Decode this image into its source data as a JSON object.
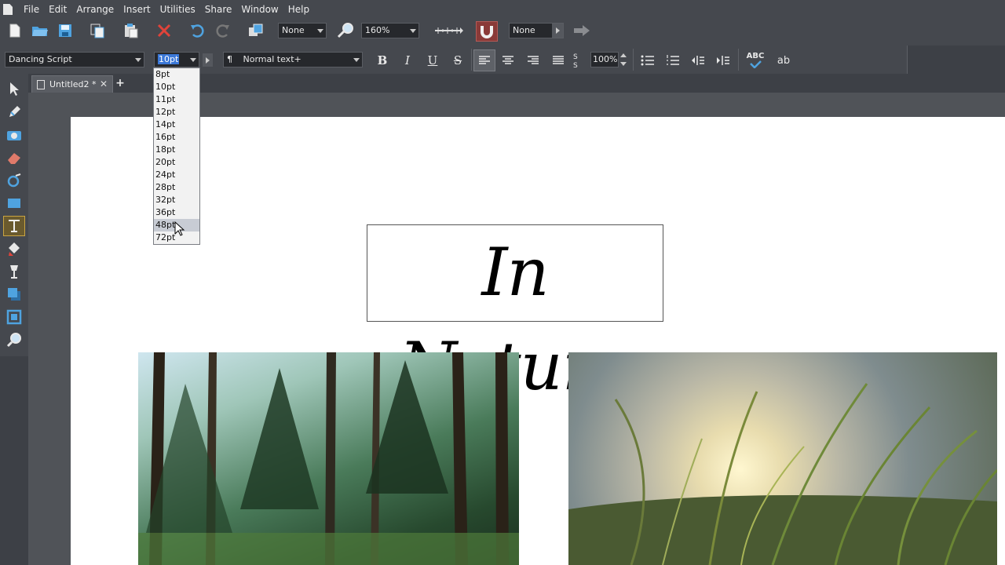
{
  "menu": [
    "File",
    "Edit",
    "Arrange",
    "Insert",
    "Utilities",
    "Share",
    "Window",
    "Help"
  ],
  "toolbar1": {
    "style_combo": "None",
    "zoom_combo": "160%",
    "snap_combo": "None"
  },
  "toolbar2": {
    "font_family": "Dancing Script",
    "font_size": "10pt",
    "paragraph_style": "Normal text+",
    "bold_label": "B",
    "italic_label": "I",
    "underline_label": "U",
    "strike_label": "S",
    "scale_value": "100%",
    "spell_label": "ABC",
    "ab_label": "ab"
  },
  "tabs": [
    {
      "label": "Untitled2 *"
    }
  ],
  "document": {
    "title": "In Nature"
  },
  "font_size_list": [
    "8pt",
    "10pt",
    "11pt",
    "12pt",
    "14pt",
    "16pt",
    "18pt",
    "20pt",
    "24pt",
    "28pt",
    "32pt",
    "36pt",
    "48pt",
    "72pt"
  ],
  "font_size_hover": "48pt",
  "colors": {
    "ui_background": "#45484e",
    "workspace": "#505358",
    "accent_tool": "#c9a441",
    "magnet_active": "#8a3a38",
    "close_red": "#e0433a",
    "icon_blue": "#4fa3e0"
  }
}
